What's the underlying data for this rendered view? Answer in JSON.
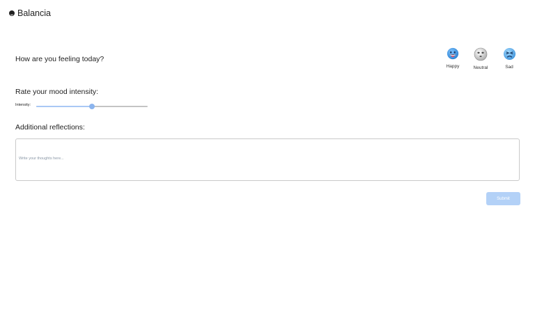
{
  "app": {
    "title": "Balancia",
    "logo_icon": "smiley-icon"
  },
  "mood_prompt": "How are you feeling today?",
  "moods": [
    {
      "label": "Happy",
      "icon": "happy-face-icon",
      "color": "#3b8fd9"
    },
    {
      "label": "Neutral",
      "icon": "neutral-face-icon",
      "color": "#cfcfcf"
    },
    {
      "label": "Sad",
      "icon": "sad-face-icon",
      "color": "#4aa0e6"
    }
  ],
  "intensity": {
    "heading": "Rate your mood intensity:",
    "label": "Intensity:",
    "value_fraction": 0.5,
    "fill_color": "#a9c8f5",
    "thumb_color": "#8bb4ee"
  },
  "reflections": {
    "heading": "Additional reflections:",
    "placeholder": "Write your thoughts here...",
    "value": ""
  },
  "submit": {
    "label": "Submit",
    "color": "#b3d1f7",
    "disabled": true
  }
}
